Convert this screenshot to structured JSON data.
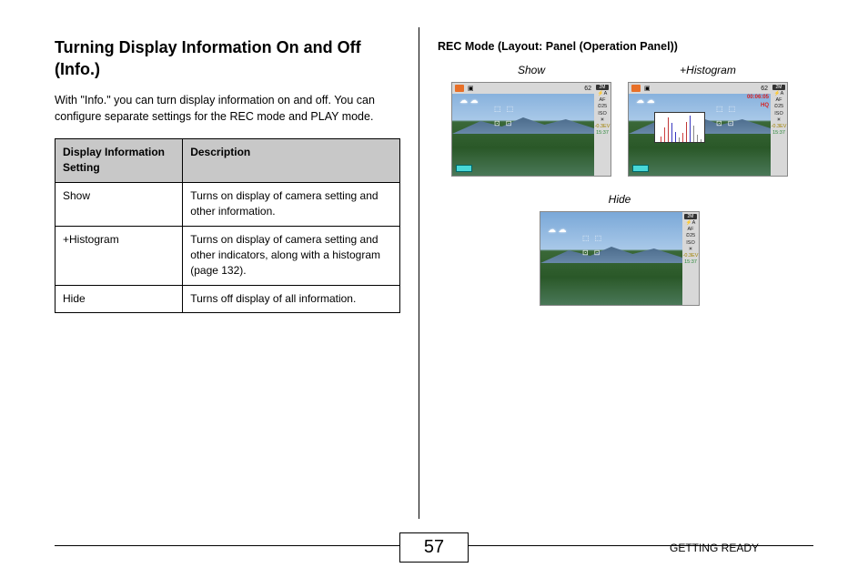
{
  "left": {
    "heading": "Turning Display Information On and Off (Info.)",
    "intro": "With \"Info.\" you can turn display information on and off. You can configure separate settings for the REC mode and PLAY mode.",
    "table": {
      "h1": "Display Information Setting",
      "h2": "Description",
      "r1c1": "Show",
      "r1c2": "Turns on display of camera setting and other information.",
      "r2c1": "+Histogram",
      "r2c2": "Turns on display of camera setting and other indicators, along with a histogram (page 132).",
      "r3c1": "Hide",
      "r3c2": "Turns off display of all information."
    }
  },
  "right": {
    "header": "REC Mode (Layout: Panel (Operation Panel))",
    "labels": {
      "show": "Show",
      "hist": "+Histogram",
      "hide": "Hide"
    },
    "topnum": "62",
    "timecode": "00:06:05",
    "hq": "HQ",
    "panel": {
      "pill": "2M",
      "flash": "⚡A",
      "af": "AF",
      "timer": "⏲25",
      "iso": "ISO",
      "wb": "☀",
      "ev": "-0.3EV",
      "time": "15:37"
    }
  },
  "footer": {
    "page": "57",
    "section": "GETTING READY"
  }
}
